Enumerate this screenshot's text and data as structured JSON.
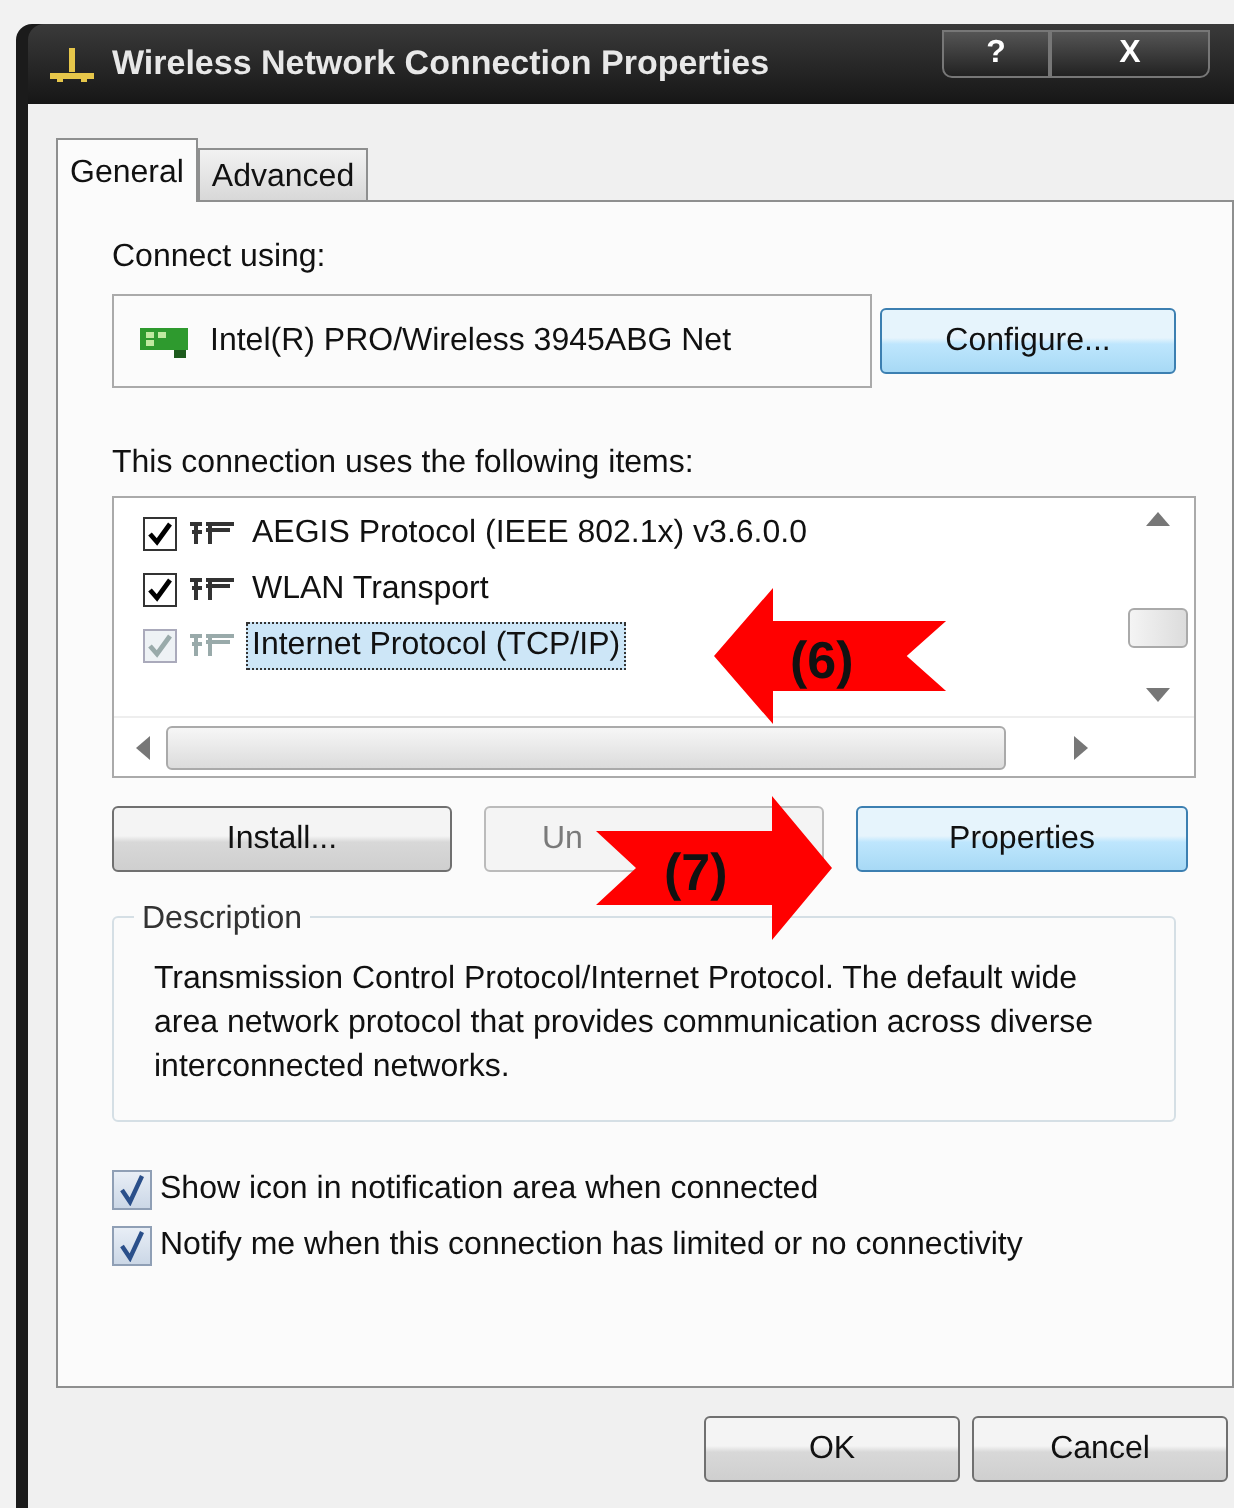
{
  "window": {
    "title": "Wireless Network Connection Properties",
    "buttons": [
      "?",
      "X"
    ]
  },
  "tabs": [
    {
      "label": "General",
      "selected": true
    },
    {
      "label": "Advanced",
      "selected": false
    }
  ],
  "connect_using": {
    "label": "Connect using:",
    "adapter": "Intel(R) PRO/Wireless 3945ABG Net",
    "button": {
      "label": "Configure...",
      "highlighted": true
    }
  },
  "items": {
    "label": "This connection uses the following items:",
    "rows": [
      {
        "label": "AEGIS Protocol (IEEE 802.1x) v3.6.0.0",
        "checked": true,
        "disabled": false,
        "selected": false
      },
      {
        "label": "WLAN Transport",
        "checked": true,
        "disabled": false,
        "selected": false
      },
      {
        "label": "Internet Protocol (TCP/IP)",
        "checked": true,
        "disabled": true,
        "selected": true
      }
    ]
  },
  "item_buttons": [
    {
      "label": "Install...",
      "disabled": false,
      "highlighted": false
    },
    {
      "label": "Un",
      "disabled": true,
      "highlighted": false
    },
    {
      "label": "Properties",
      "disabled": false,
      "highlighted": true
    }
  ],
  "description": {
    "legend": "Description",
    "text": "Transmission Control Protocol/Internet Protocol. The default wide area network protocol that provides communication across diverse interconnected networks."
  },
  "options": [
    {
      "label": "Show icon in notification area when connected",
      "checked": true
    },
    {
      "label": "Notify me when this connection has limited or no connectivity",
      "checked": true
    }
  ],
  "footer_buttons": [
    {
      "label": "OK"
    },
    {
      "label": "Cancel"
    }
  ],
  "annotations": [
    {
      "label": "(6)",
      "kind": "left"
    },
    {
      "label": "(7)",
      "kind": "right"
    }
  ]
}
